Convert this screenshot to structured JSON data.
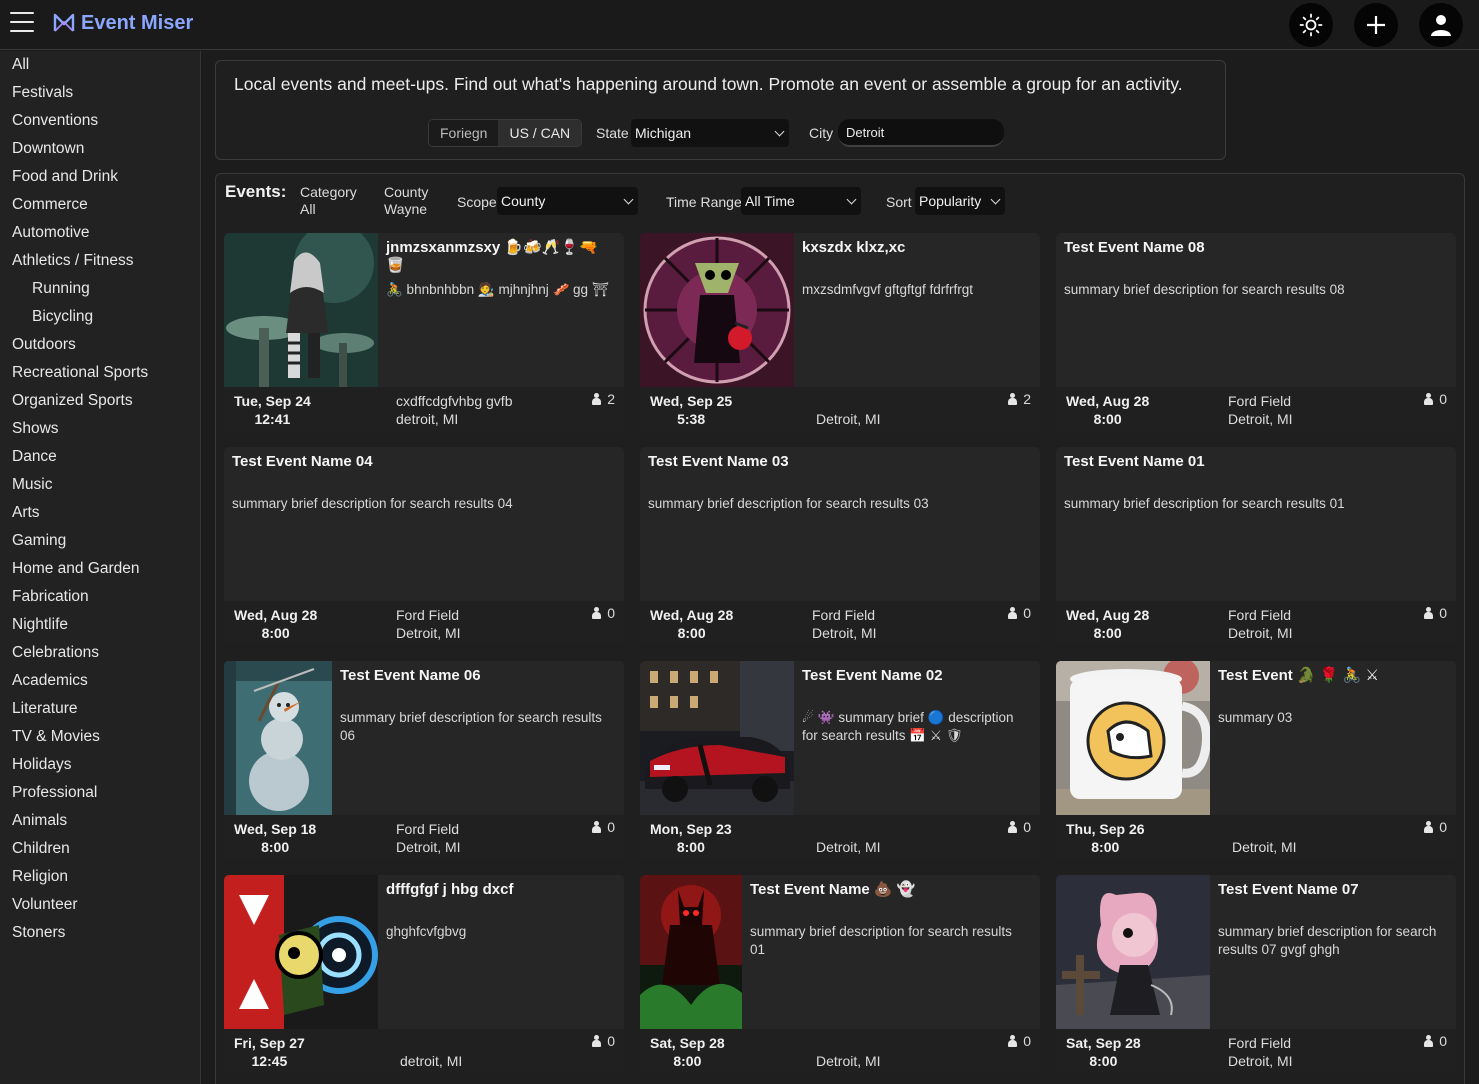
{
  "app": {
    "brand": "Event Miser"
  },
  "sidebar": [
    {
      "label": "All"
    },
    {
      "label": "Festivals"
    },
    {
      "label": "Conventions"
    },
    {
      "label": "Downtown"
    },
    {
      "label": "Food and Drink"
    },
    {
      "label": "Commerce"
    },
    {
      "label": "Automotive"
    },
    {
      "label": "Athletics / Fitness"
    },
    {
      "label": "Running",
      "sub": true
    },
    {
      "label": "Bicycling",
      "sub": true
    },
    {
      "label": "Outdoors"
    },
    {
      "label": "Recreational Sports"
    },
    {
      "label": "Organized Sports"
    },
    {
      "label": "Shows"
    },
    {
      "label": "Dance"
    },
    {
      "label": "Music"
    },
    {
      "label": "Arts"
    },
    {
      "label": "Gaming"
    },
    {
      "label": "Home and Garden"
    },
    {
      "label": "Fabrication"
    },
    {
      "label": "Nightlife"
    },
    {
      "label": "Celebrations"
    },
    {
      "label": "Academics"
    },
    {
      "label": "Literature"
    },
    {
      "label": "TV & Movies"
    },
    {
      "label": "Holidays"
    },
    {
      "label": "Professional"
    },
    {
      "label": "Animals"
    },
    {
      "label": "Children"
    },
    {
      "label": "Religion"
    },
    {
      "label": "Volunteer"
    },
    {
      "label": "Stoners"
    }
  ],
  "intro": {
    "text": "Local events and meet-ups. Find out what's happening around town. Promote an event or assemble a group for an activity.",
    "region_foreign": "Foriegn",
    "region_us": "US / CAN",
    "state_label": "State",
    "state_value": "Michigan",
    "city_label": "City",
    "city_value": "Detroit"
  },
  "filters": {
    "title": "Events:",
    "category_label": "Category",
    "category_value": "All",
    "county_label": "County",
    "county_value": "Wayne",
    "scope_label": "Scope",
    "scope_value": "County",
    "time_label": "Time Range",
    "time_value": "All Time",
    "sort_label": "Sort",
    "sort_value": "Popularity"
  },
  "events": [
    {
      "title": "jnmzsxanmzsxy 🍺🍻🥂🍷🔫🥃",
      "desc": "🚴 bhnbnhbbn 🧑‍🎨 mjhnjhnj 🥓 gg ⛩",
      "date": "Tue, Sep 24",
      "time": "12:41",
      "venue": "cxdffcdgfvhbg gvfb",
      "city": "detroit, MI",
      "count": "2",
      "image": "gothic-doll"
    },
    {
      "title": "kxszdx klxz,xc",
      "desc": "mxzsdmfvgvf gftgftgf fdrfrfrgt",
      "date": "Wed, Sep 25",
      "time": "5:38",
      "venue": "",
      "city": "Detroit, MI",
      "count": "2",
      "image": "stained-glass"
    },
    {
      "title": "Test Event Name 08",
      "desc": "summary brief description for search results 08",
      "date": "Wed, Aug 28",
      "time": "8:00",
      "venue": "Ford Field",
      "city": "Detroit, MI",
      "count": "0",
      "image": ""
    },
    {
      "title": "Test Event Name 04",
      "desc": "summary brief description for search results 04",
      "date": "Wed, Aug 28",
      "time": "8:00",
      "venue": "Ford Field",
      "city": "Detroit, MI",
      "count": "0",
      "image": ""
    },
    {
      "title": "Test Event Name 03",
      "desc": "summary brief description for search results 03",
      "date": "Wed, Aug 28",
      "time": "8:00",
      "venue": "Ford Field",
      "city": "Detroit, MI",
      "count": "0",
      "image": ""
    },
    {
      "title": "Test Event Name 01",
      "desc": "summary brief description for search results 01",
      "date": "Wed, Aug 28",
      "time": "8:00",
      "venue": "Ford Field",
      "city": "Detroit, MI",
      "count": "0",
      "image": ""
    },
    {
      "title": "Test Event Name 06",
      "desc": "summary brief description for search results 06",
      "date": "Wed, Sep 18",
      "time": "8:00",
      "venue": "Ford Field",
      "city": "Detroit, MI",
      "count": "0",
      "image": "snowman"
    },
    {
      "title": "Test Event Name 02",
      "desc": "☄ 👾 summary brief 🔵 description for search results 📅 ⚔ 🛡",
      "date": "Mon, Sep 23",
      "time": "8:00",
      "venue": "",
      "city": "Detroit, MI",
      "count": "0",
      "image": "sports-car"
    },
    {
      "title": "Test Event 🐊 🌹 🚴 ⚔",
      "desc": "summary 03",
      "date": "Thu, Sep 26",
      "time": "8:00",
      "venue": "",
      "city": "Detroit, MI",
      "count": "0",
      "image": "mug"
    },
    {
      "title": "dfffgfgf j hbg dxcf",
      "desc": "ghghfcvfgbvg",
      "date": "Fri, Sep 27",
      "time": "12:45",
      "venue": "",
      "city": "detroit, MI",
      "count": "0",
      "image": "robot"
    },
    {
      "title": "Test Event Name 💩 👻",
      "desc": "summary brief description for search results 01",
      "date": "Sat, Sep 28",
      "time": "8:00",
      "venue": "",
      "city": "Detroit, MI",
      "count": "0",
      "image": "demon"
    },
    {
      "title": "Test Event Name 07",
      "desc": "summary brief description for search results 07 gvgf ghgh",
      "date": "Sat, Sep 28",
      "time": "8:00",
      "venue": "Ford Field",
      "city": "Detroit, MI",
      "count": "0",
      "image": "pony"
    }
  ]
}
